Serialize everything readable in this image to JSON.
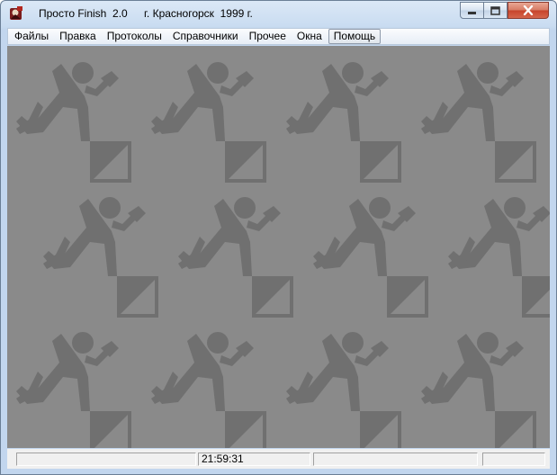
{
  "window": {
    "title": "Просто Finish  2.0",
    "city_year": "г. Красногорск  1999 г."
  },
  "controls": {
    "minimize": "minimize-icon",
    "maximize": "maximize-icon",
    "close": "close-icon"
  },
  "menu": {
    "items": [
      {
        "label": "Файлы"
      },
      {
        "label": "Правка"
      },
      {
        "label": "Протоколы"
      },
      {
        "label": "Справочники"
      },
      {
        "label": "Прочее"
      },
      {
        "label": "Окна"
      },
      {
        "label": "Помощь",
        "active": true
      }
    ]
  },
  "background": {
    "icon": "orienteering-runner-icon",
    "tile_color": "#8a8a8a",
    "figure_color": "#707070"
  },
  "statusbar": {
    "panel1": "",
    "time": "21:59:31",
    "panel3": "",
    "panel4": ""
  }
}
